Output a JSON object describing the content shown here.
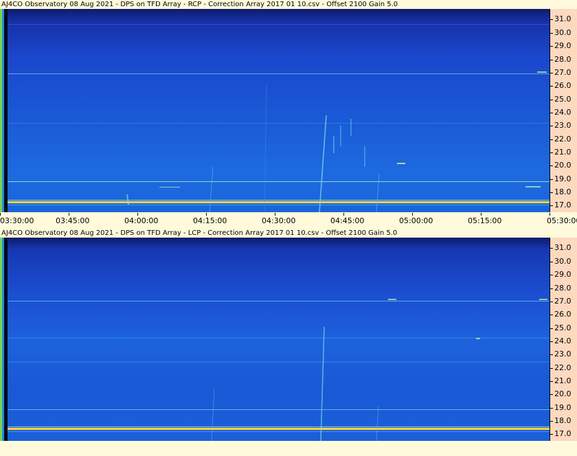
{
  "panels": [
    {
      "title": "AJ4CO Observatory 08 Aug 2021  -  DPS on TFD Array  -  RCP  -  Correction Array 2017 01 10.csv  -  Offset 2100  Gain 5.0",
      "polarization": "RCP"
    },
    {
      "title": "AJ4CO Observatory 08 Aug 2021  -  DPS on TFD Array  -  LCP  -  Correction Array 2017 01 10.csv  -  Offset 2100  Gain 5.0",
      "polarization": "LCP"
    }
  ],
  "chart_data": {
    "type": "heatmap",
    "y_ticks": [
      "31.0",
      "30.0",
      "29.0",
      "28.0",
      "27.0",
      "26.0",
      "25.0",
      "24.0",
      "23.0",
      "22.0",
      "21.0",
      "20.0",
      "19.0",
      "18.0",
      "17.0"
    ],
    "x_ticks": [
      "03:30:00",
      "03:45:00",
      "04:00:00",
      "04:15:00",
      "04:30:00",
      "04:45:00",
      "05:00:00",
      "05:15:00",
      "05:30:00"
    ],
    "ylim": [
      16.5,
      31.8
    ],
    "xlim": [
      "03:30:00",
      "05:30:00"
    ],
    "colors": {
      "background": "#fffadb",
      "axis_panel": "#fcd9bf",
      "low_intensity": "#0d1c6b",
      "mid_intensity": "#1c62dc",
      "interference_line": "#ffd24a"
    }
  }
}
